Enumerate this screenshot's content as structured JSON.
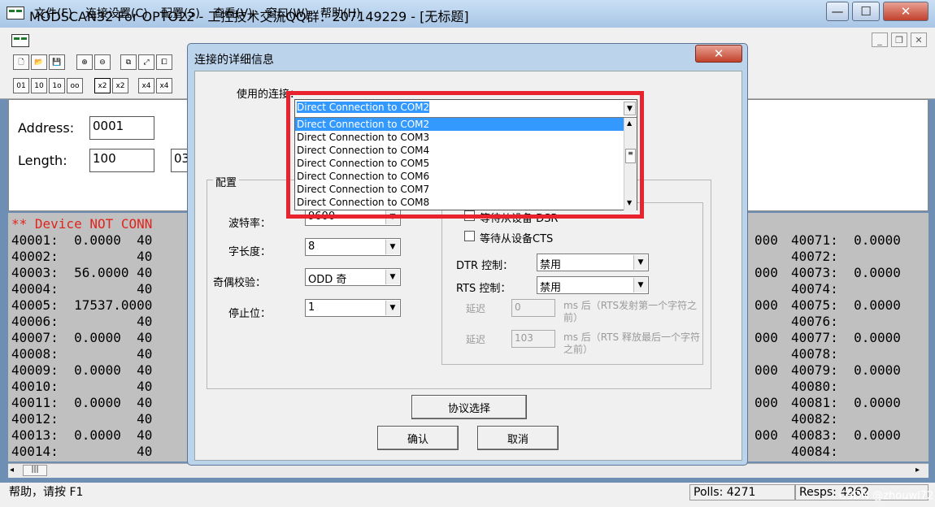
{
  "window": {
    "title": "MODSCAN32 For OPTO22 - 工控技术交流QQ群：207149229 - [无标题]",
    "min": "—",
    "max": "☐",
    "close": "✕"
  },
  "menu": [
    "文件(F)",
    "连接设置(C)",
    "配置(S)",
    "查看(V)",
    "窗口(W)",
    "帮助(H)"
  ],
  "mdi": {
    "min": "_",
    "restore": "❐",
    "close": "✕"
  },
  "toolbar": {
    "row1": [
      "🗋",
      "📂",
      "💾",
      "⊕",
      "⊖",
      "⧉",
      "⤢",
      "⧠"
    ],
    "row2": [
      "01",
      "10",
      "1o",
      "oo",
      "x2",
      "x2",
      "x4",
      "x4"
    ]
  },
  "doc": {
    "address_label": "Address:",
    "address_value": "0001",
    "length_label": "Length:",
    "length_value": "100",
    "device_value": "03"
  },
  "grid": {
    "error": "** Device NOT CONN",
    "left_rows": [
      "40001:  0.0000  40",
      "40002:          40",
      "40003:  56.0000 40",
      "40004:          40",
      "40005:  17537.0000",
      "40006:          40",
      "40007:  0.0000  40",
      "40008:          40",
      "40009:  0.0000  40",
      "40010:          40",
      "40011:  0.0000  40",
      "40012:          40",
      "40013:  0.0000  40",
      "40014:          40"
    ],
    "mid_rows": [
      "000",
      "",
      "000",
      "",
      "000",
      "",
      "000",
      "",
      "000",
      "",
      "000",
      "",
      "000",
      ""
    ],
    "right_rows": [
      "40071:  0.0000",
      "40072:",
      "40073:  0.0000",
      "40074:",
      "40075:  0.0000",
      "40076:",
      "40077:  0.0000",
      "40078:",
      "40079:  0.0000",
      "40080:",
      "40081:  0.0000",
      "40082:",
      "40083:  0.0000",
      "40084:"
    ]
  },
  "status": {
    "help": "帮助，请按 F1",
    "polls": "Polls: 4271",
    "resps": "Resps: 4262",
    "watermark": "CSDN @zhouwl72"
  },
  "dialog": {
    "title": "连接的详细信息",
    "close": "✕",
    "connection_label": "使用的连接：",
    "connection_value": "Direct Connection to COM2",
    "options": [
      "Direct Connection to COM2",
      "Direct Connection to COM3",
      "Direct Connection to COM4",
      "Direct Connection to COM5",
      "Direct Connection to COM6",
      "Direct Connection to COM7",
      "Direct Connection to COM8"
    ],
    "config_group": "配置",
    "baud_label": "波特率：",
    "baud_value": "9600",
    "databits_label": "字长度：",
    "databits_value": "8",
    "parity_label": "奇偶校验：",
    "parity_value": "ODD 奇",
    "stopbits_label": "停止位：",
    "stopbits_value": "1",
    "wait_dsr": "等待从设备 DSR",
    "wait_cts": "等待从设备CTS",
    "dtr_label": "DTR 控制：",
    "dtr_value": "禁用",
    "rts_label": "RTS 控制：",
    "rts_value": "禁用",
    "delay1_label": "延迟",
    "delay1_value": "0",
    "delay1_text": "ms 后（RTS发射第一个字符之前）",
    "delay2_label": "延迟",
    "delay2_value": "103",
    "delay2_text": "ms 后（RTS 释放最后一个字符之前）",
    "protocol_button": "协议选择",
    "ok_button": "确认",
    "cancel_button": "取消"
  }
}
